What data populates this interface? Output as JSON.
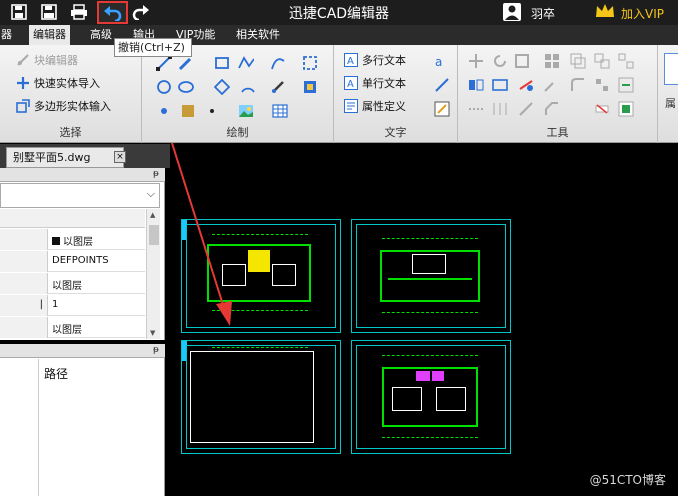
{
  "app": {
    "title": "迅捷CAD编辑器",
    "user": "羽卒",
    "vip_label": "加入VIP"
  },
  "menu": {
    "tabs": [
      "器",
      "编辑器",
      "高级",
      "输出",
      "VIP功能",
      "相关软件"
    ],
    "active": "编辑器"
  },
  "tooltip": {
    "text": "撤销(Ctrl+Z)"
  },
  "ribbon": {
    "select": {
      "label": "选择",
      "items": [
        "块编辑器",
        "快速实体导入",
        "多边形实体输入"
      ]
    },
    "draw": {
      "label": "绘制"
    },
    "text": {
      "label": "文字",
      "items": [
        "多行文本",
        "单行文本",
        "属性定义"
      ]
    },
    "tools": {
      "label": "工具"
    },
    "extra": {
      "label": "属"
    }
  },
  "document": {
    "tab_label": "别墅平面5.dwg",
    "close": "×"
  },
  "properties": {
    "pin": "ᵽ",
    "rows": [
      "以图层",
      "DEFPOINTS",
      "以图层",
      "1",
      "以图层"
    ],
    "row_keys": [
      "",
      "",
      "",
      "|",
      ""
    ],
    "scroll_up": "▲",
    "scroll_down": "▼",
    "dropdown": "⌵"
  },
  "paths_panel": {
    "pin": "ᵽ",
    "header": "路径"
  },
  "watermark": "@51CTO博客",
  "colors": {
    "highlight": "#e53935",
    "cyan": "#00c8c8",
    "green": "#00e000",
    "vip": "#f5c518"
  }
}
